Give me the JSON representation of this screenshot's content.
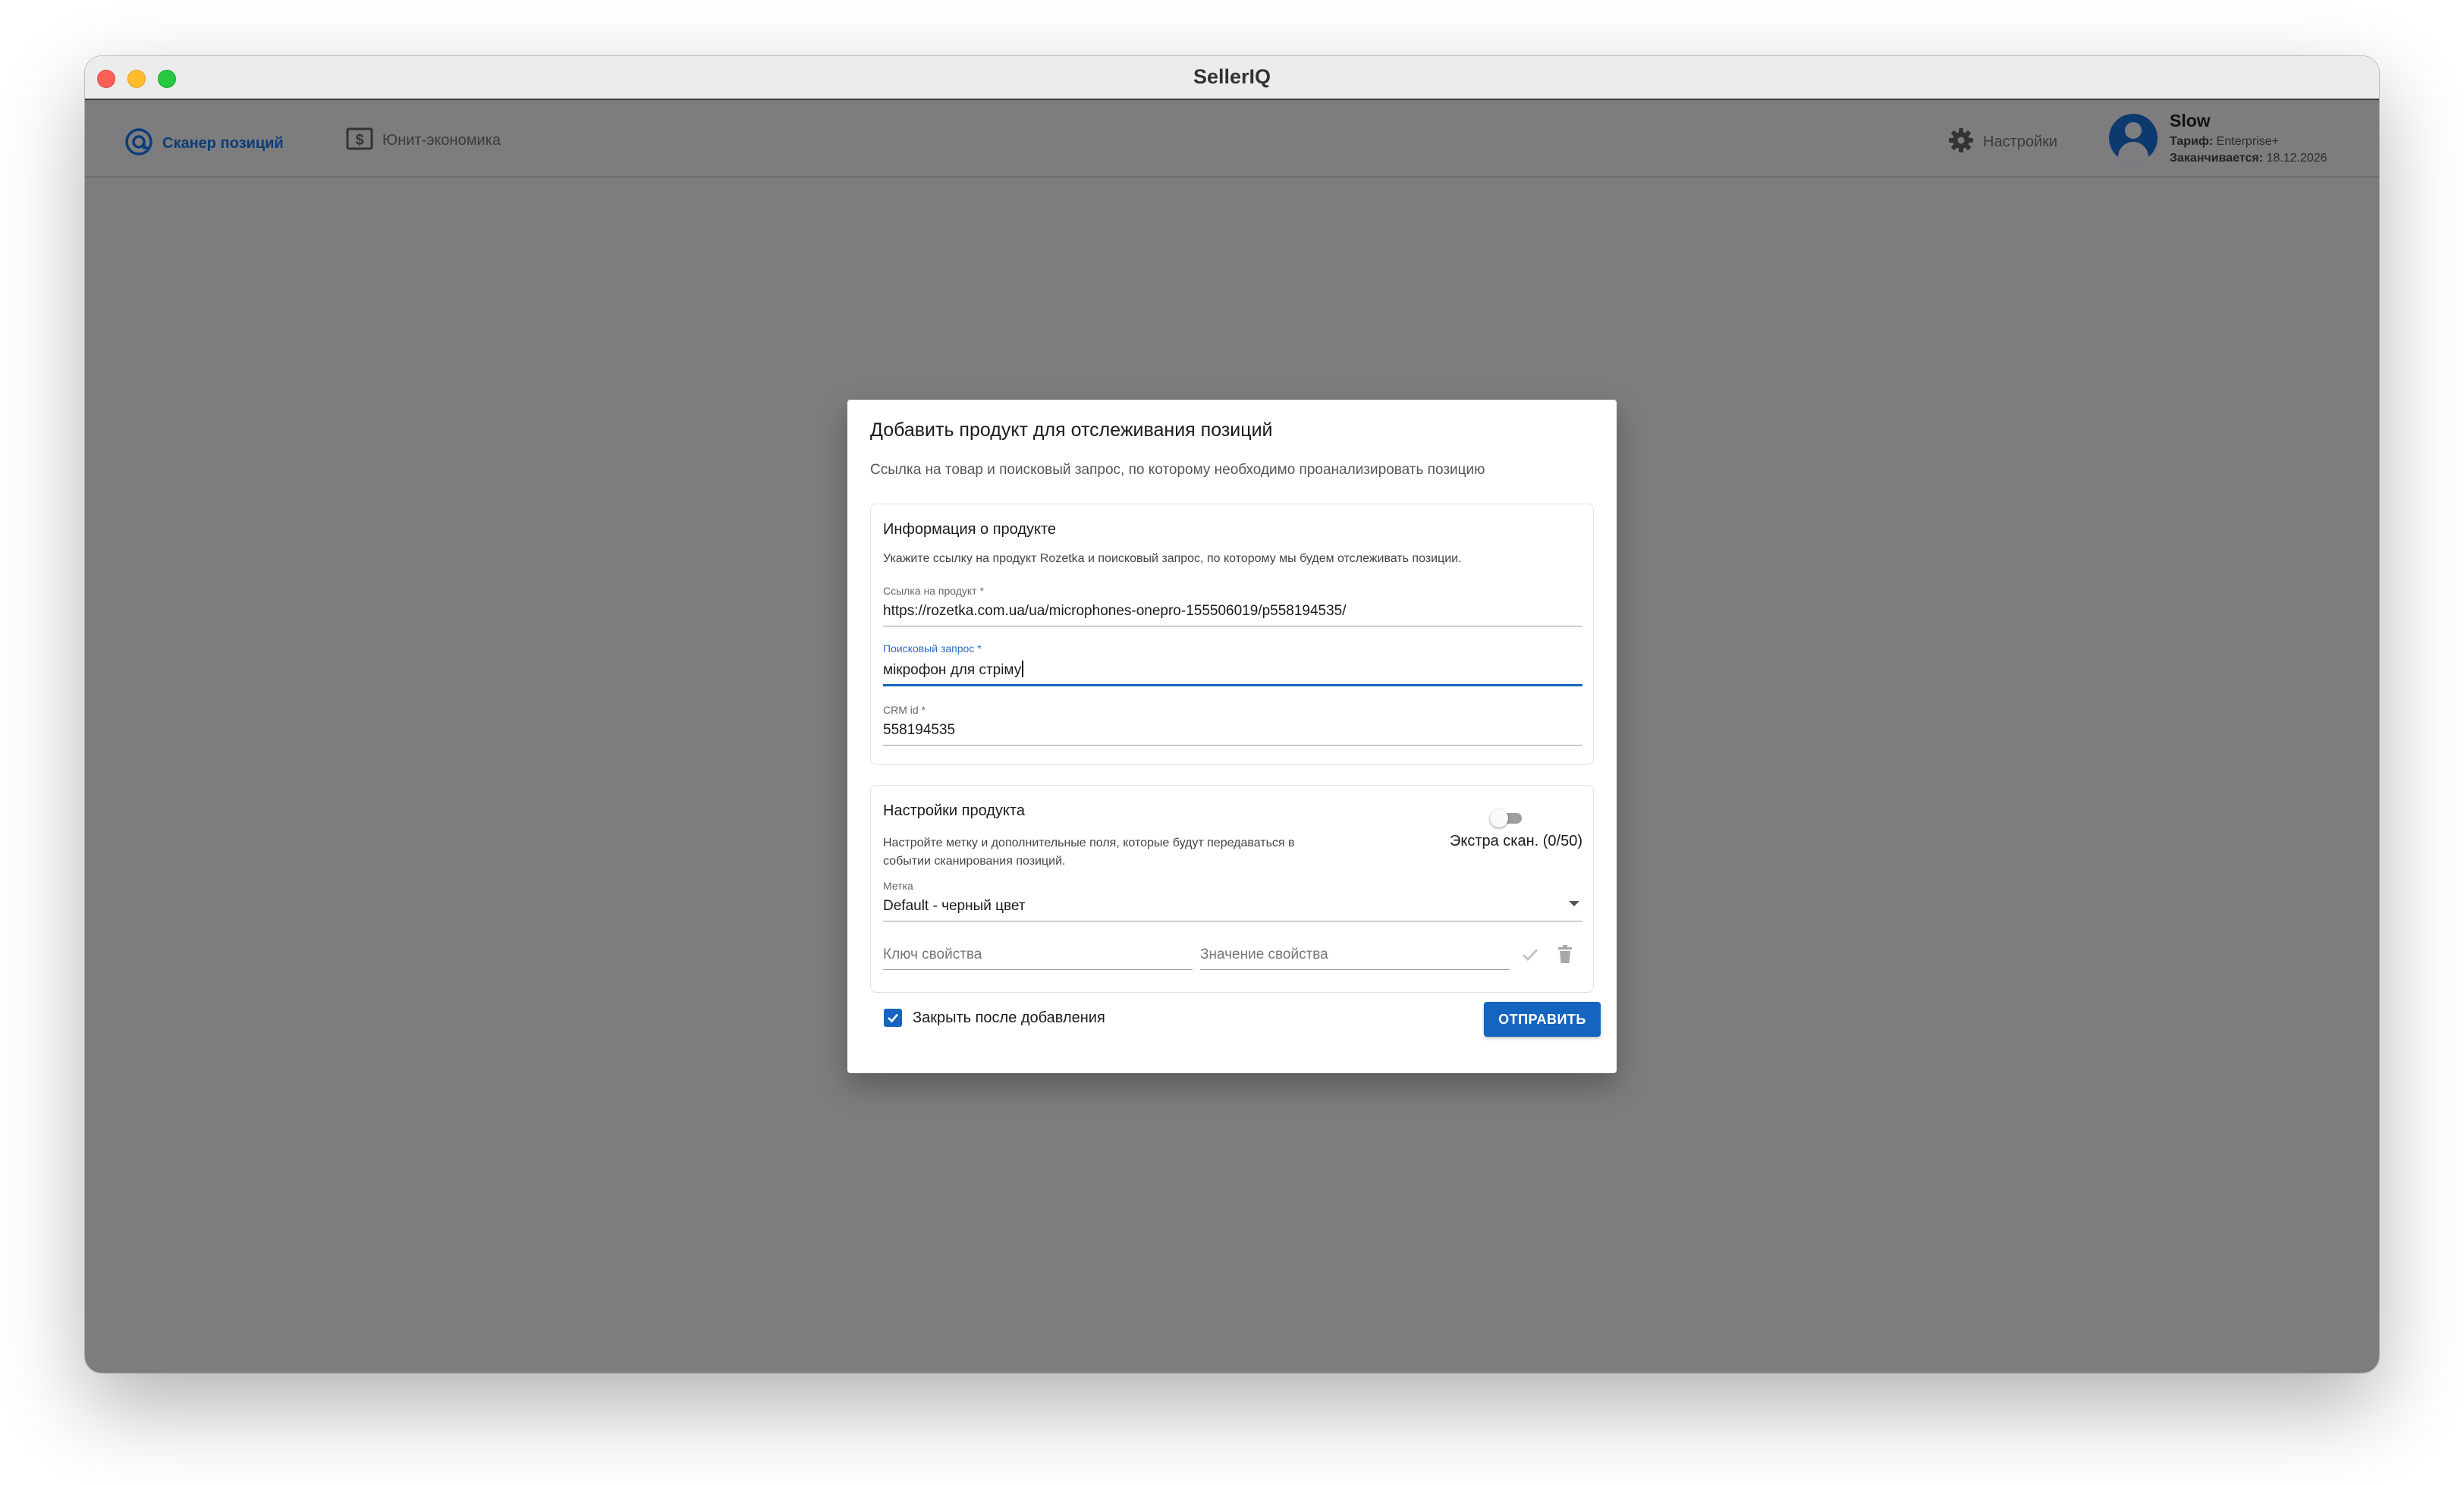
{
  "window": {
    "title": "SellerIQ"
  },
  "nav": {
    "scanner_label": "Сканер позиций",
    "unit_label": "Юнит-экономика",
    "settings_label": "Настройки"
  },
  "user": {
    "name": "Slow",
    "plan_key": "Тариф:",
    "plan_value": "Enterprise+",
    "expires_key": "Заканчивается:",
    "expires_value": "18.12.2026"
  },
  "dialog": {
    "title": "Добавить продукт для отслеживания позиций",
    "subtitle": "Ссылка на товар и поисковый запрос, по которому необходимо проанализировать позицию",
    "info": {
      "title": "Информация о продукте",
      "description": "Укажите ссылку на продукт Rozetka и поисковый запрос, по которому мы будем отслеживать позиции.",
      "product_link_label": "Ссылка на продукт *",
      "product_link_value": "https://rozetka.com.ua/ua/microphones-onepro-155506019/p558194535/",
      "query_label": "Поисковый запрос *",
      "query_value": "мікрофон для стріму",
      "crm_label": "CRM id *",
      "crm_value": "558194535"
    },
    "settings": {
      "title": "Настройки продукта",
      "description_line1": "Настройте метку и дополнительные поля, которые будут передаваться в",
      "description_line2": "событии сканирования позиций.",
      "extra_scan_label": "Экстра скан. (0/50)",
      "extra_scan_enabled": false,
      "tag_label": "Метка",
      "tag_value": "Default - черный цвет",
      "property_key_placeholder": "Ключ свойства",
      "property_value_placeholder": "Значение свойства"
    },
    "close_after_add_label": "Закрыть после добавления",
    "close_after_add_checked": true,
    "submit_label": "ОТПРАВИТЬ"
  },
  "colors": {
    "accent": "#1565c0",
    "overlay": "#7d7d7f",
    "nav_active": "#0b3d78"
  }
}
